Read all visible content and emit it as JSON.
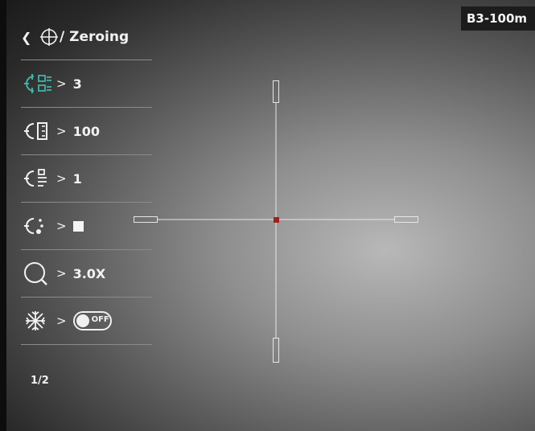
{
  "badge": "B3-100m",
  "header": {
    "back_icon": "chevron-left-icon",
    "target_icon": "crosshair-icon",
    "title": "/ Zeroing"
  },
  "menu_items": [
    {
      "icon": "zero-profile-icon",
      "value": "3",
      "active": true
    },
    {
      "icon": "zero-distance-icon",
      "value": "100"
    },
    {
      "icon": "zero-adjust-icon",
      "value": "1"
    },
    {
      "icon": "reticle-style-icon",
      "value": ""
    },
    {
      "icon": "magnifier-icon",
      "value": "3.0X"
    },
    {
      "icon": "freeze-icon",
      "value": "OFF"
    }
  ],
  "arrow": ">",
  "pagination": "1/2",
  "colors": {
    "accent": "#3fb3a6",
    "center_dot": "#a02020",
    "text": "#f2f2f2"
  }
}
